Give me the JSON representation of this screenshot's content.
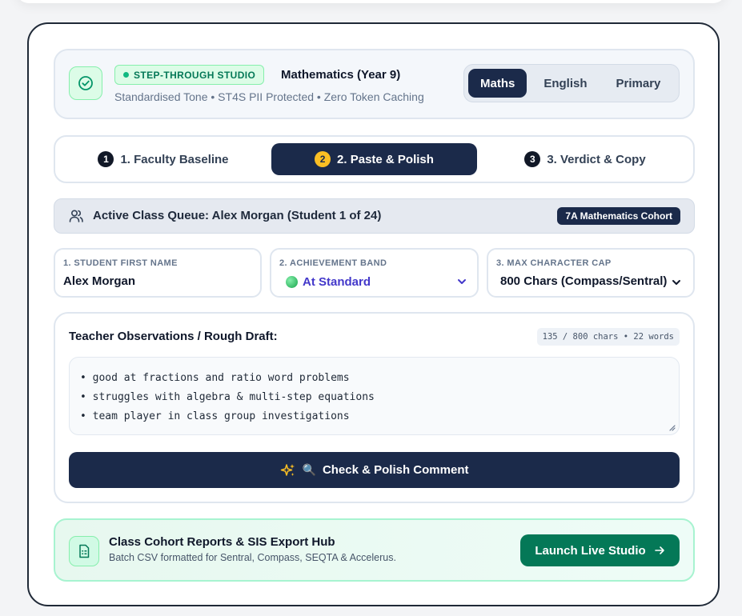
{
  "header": {
    "badge": "STEP-THROUGH STUDIO",
    "subject": "Mathematics (Year 9)",
    "subtitle": "Standardised Tone • ST4S PII Protected • Zero Token Caching",
    "subjects": [
      {
        "label": "Maths",
        "active": true
      },
      {
        "label": "English",
        "active": false
      },
      {
        "label": "Primary",
        "active": false
      }
    ]
  },
  "steps": [
    {
      "num": "1",
      "label": "1. Faculty Baseline",
      "active": false
    },
    {
      "num": "2",
      "label": "2. Paste & Polish",
      "active": true
    },
    {
      "num": "3",
      "label": "3. Verdict & Copy",
      "active": false
    }
  ],
  "queue": {
    "text": "Active Class Queue: Alex Morgan (Student 1 of 24)",
    "cohort": "7A Mathematics Cohort"
  },
  "fields": {
    "student": {
      "label": "1. STUDENT FIRST NAME",
      "value": "Alex Morgan"
    },
    "band": {
      "label": "2. ACHIEVEMENT BAND",
      "value": "At Standard"
    },
    "cap": {
      "label": "3. MAX CHARACTER CAP",
      "value": "800 Chars (Compass/Sentral)"
    }
  },
  "draft": {
    "title": "Teacher Observations / Rough Draft:",
    "counter": "135 / 800 chars • 22 words",
    "lines": [
      "• good at fractions and ratio word problems",
      "• struggles with algebra & multi-step equations",
      "• team player in class group investigations"
    ],
    "cta": "Check & Polish Comment",
    "cta_emoji": "🔍"
  },
  "hub": {
    "title": "Class Cohort Reports & SIS Export Hub",
    "subtitle": "Batch CSV formatted for Sentral, Compass, SEQTA & Accelerus.",
    "button": "Launch Live Studio"
  },
  "colors": {
    "navy": "#1b2a4a",
    "green": "#047857",
    "accent_yellow": "#fbbf24",
    "band_text": "#4338ca"
  },
  "icons": [
    "check-circle-icon",
    "users-icon",
    "chevron-down-icon",
    "sparkles-icon",
    "magnifier-icon",
    "spreadsheet-icon",
    "arrow-right-icon",
    "resize-grip-icon"
  ]
}
